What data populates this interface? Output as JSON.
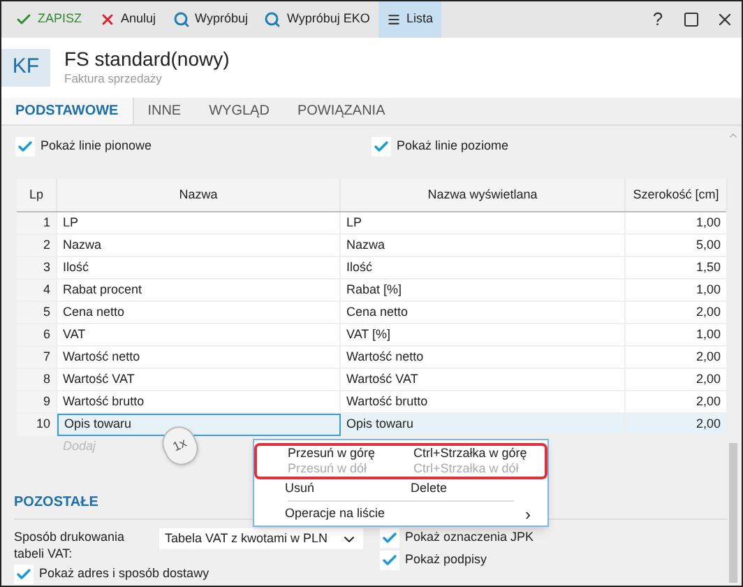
{
  "toolbar": {
    "buttons": [
      {
        "label": "ZAPISZ",
        "selected": false
      },
      {
        "label": "Anuluj",
        "selected": false
      },
      {
        "label": "Wypróbuj",
        "selected": false
      },
      {
        "label": "Wypróbuj EKO",
        "selected": false
      },
      {
        "label": "Lista",
        "selected": true
      }
    ],
    "help": "?"
  },
  "header": {
    "badge": "KF",
    "title": "FS standard(nowy)",
    "subtitle": "Faktura sprzedaży"
  },
  "tabs": [
    {
      "label": "PODSTAWOWE",
      "selected": true
    },
    {
      "label": "INNE",
      "selected": false
    },
    {
      "label": "WYGLĄD",
      "selected": false
    },
    {
      "label": "POWIĄZANIA",
      "selected": false
    }
  ],
  "top_options": [
    {
      "label": "Pokaż linie pionowe",
      "checked": true
    },
    {
      "label": "Pokaż linie poziome",
      "checked": true
    }
  ],
  "table": {
    "columns": [
      "Lp",
      "Nazwa",
      "Nazwa wyświetlana",
      "Szerokość [cm]"
    ],
    "rows": [
      {
        "cells": [
          "1",
          "LP",
          "LP",
          "1,00"
        ],
        "selected": false
      },
      {
        "cells": [
          "2",
          "Nazwa",
          "Nazwa",
          "5,00"
        ],
        "selected": false
      },
      {
        "cells": [
          "3",
          "Ilość",
          "Ilość",
          "1,50"
        ],
        "selected": false
      },
      {
        "cells": [
          "4",
          "Rabat procent",
          "Rabat [%]",
          "1,00"
        ],
        "selected": false
      },
      {
        "cells": [
          "5",
          "Cena netto",
          "Cena netto",
          "2,00"
        ],
        "selected": false
      },
      {
        "cells": [
          "6",
          "VAT",
          "VAT [%]",
          "1,00"
        ],
        "selected": false
      },
      {
        "cells": [
          "7",
          "Wartość netto",
          "Wartość netto",
          "2,00"
        ],
        "selected": false
      },
      {
        "cells": [
          "8",
          "Wartość VAT",
          "Wartość VAT",
          "2,00"
        ],
        "selected": false
      },
      {
        "cells": [
          "9",
          "Wartość brutto",
          "Wartość brutto",
          "2,00"
        ],
        "selected": false
      },
      {
        "cells": [
          "10",
          "Opis towaru",
          "Opis towaru",
          "2,00"
        ],
        "selected": true
      }
    ],
    "new_row_placeholder": "Dodaj"
  },
  "section": {
    "title": "POZOSTAŁE",
    "vat_table": {
      "label": "Sposób drukowania tabeli VAT:",
      "value": "Tabela VAT z kwotami w PLN"
    },
    "left_options": [
      {
        "label": "Pokaż adres i sposób dostawy",
        "checked": true
      }
    ],
    "right_options": [
      {
        "label": "Pokaż oznaczenia JPK",
        "checked": true
      },
      {
        "label": "Pokaż podpisy",
        "checked": true
      }
    ]
  },
  "context_menu": {
    "items": [
      {
        "kind": "item",
        "label": "Przesuń w górę",
        "shortcut": "Ctrl+Strzałka w górę",
        "disabled": false,
        "highlighted": true
      },
      {
        "kind": "item",
        "label": "Przesuń w dół",
        "shortcut": "Ctrl+Strzałka w dół",
        "disabled": true,
        "highlighted": true
      },
      {
        "kind": "item",
        "label": "Usuń",
        "shortcut": "Delete",
        "disabled": false,
        "highlighted": false
      },
      {
        "kind": "separator"
      },
      {
        "kind": "submenu",
        "label": "Operacje na liście",
        "arrow": "›",
        "disabled": false,
        "highlighted": false
      }
    ]
  },
  "mouse_hint": {
    "label": "1x"
  }
}
